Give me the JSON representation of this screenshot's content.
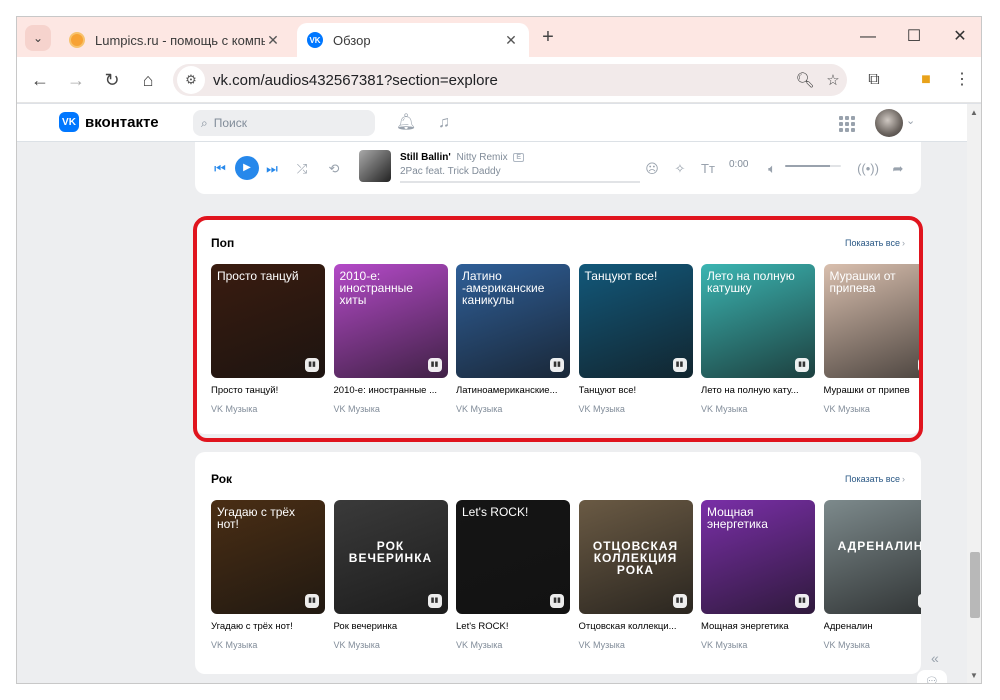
{
  "browser": {
    "tabs": [
      {
        "title": "Lumpics.ru - помощь с компьк",
        "active": false
      },
      {
        "title": "Обзор",
        "active": true
      }
    ],
    "address": "vk.com/audios432567381?section=explore",
    "icons": {
      "tab_list": "chevron-down-icon",
      "new_tab": "plus-icon",
      "back": "arrow-left-icon",
      "forward": "arrow-right-icon",
      "reload": "reload-icon",
      "home": "home-icon",
      "zoom": "zoom-icon",
      "bookmark": "star-icon",
      "extensions": "puzzle-icon",
      "menu": "kebab-icon"
    }
  },
  "vk": {
    "logo": "вконтакте",
    "search_placeholder": "Поиск",
    "player": {
      "title": "Still Ballin'",
      "remix": "Nitty Remix",
      "explicit": "E",
      "artist": "2Pac feat. Trick Daddy",
      "time": "0:00",
      "volume_fraction": 0.8
    },
    "sections": [
      {
        "title": "Поп",
        "show_all": "Показать все",
        "items": [
          {
            "cover_text": "Просто танцуй",
            "name": "Просто танцуй!",
            "by": "VK Музыка",
            "bg": "#3a1c10"
          },
          {
            "cover_text": "2010-е: иностранные хиты",
            "name": "2010-е: иностранные ...",
            "by": "VK Музыка",
            "bg": "#b44ac8"
          },
          {
            "cover_text": "Латино -американские каникулы",
            "name": "Латиноамериканские...",
            "by": "VK Музыка",
            "bg": "#2f5f98"
          },
          {
            "cover_text": "Танцуют все!",
            "name": "Танцуют все!",
            "by": "VK Музыка",
            "bg": "#12587a"
          },
          {
            "cover_text": "Лето на полную катушку",
            "name": "Лето на полную кату...",
            "by": "VK Музыка",
            "bg": "#3bb5b2"
          },
          {
            "cover_text": "Мурашки от припева",
            "name": "Мурашки от припев",
            "by": "VK Музыка",
            "bg": "#d9bfae"
          }
        ]
      },
      {
        "title": "Рок",
        "show_all": "Показать все",
        "items": [
          {
            "cover_text": "Угадаю с трёх нот!",
            "name": "Угадаю с трёх нот!",
            "by": "VK Музыка",
            "bg": "#4a2e14",
            "center": false
          },
          {
            "cover_text": "РОК ВЕЧЕРИНКА",
            "name": "Рок вечеринка",
            "by": "VK Музыка",
            "bg": "#3a3a3a",
            "center": true
          },
          {
            "cover_text": "Let's ROCK!",
            "name": "Let's ROCK!",
            "by": "VK Музыка",
            "bg": "#151515",
            "center": false
          },
          {
            "cover_text": "ОТЦОВСКАЯ КОЛЛЕКЦИЯ РОКА",
            "name": "Отцовская коллекци...",
            "by": "VK Музыка",
            "bg": "#6a5a44",
            "center": true
          },
          {
            "cover_text": "Мощная энергетика",
            "name": "Мощная энергетика",
            "by": "VK Музыка",
            "bg": "#7a2fa8",
            "center": false
          },
          {
            "cover_text": "АДРЕНАЛИН",
            "name": "Адреналин",
            "by": "VK Музыка",
            "bg": "#7d8a8c",
            "center": true
          }
        ]
      }
    ]
  },
  "colors": {
    "accent": "#2688eb",
    "highlight": "#e0141e",
    "vk_blue": "#0077ff"
  }
}
